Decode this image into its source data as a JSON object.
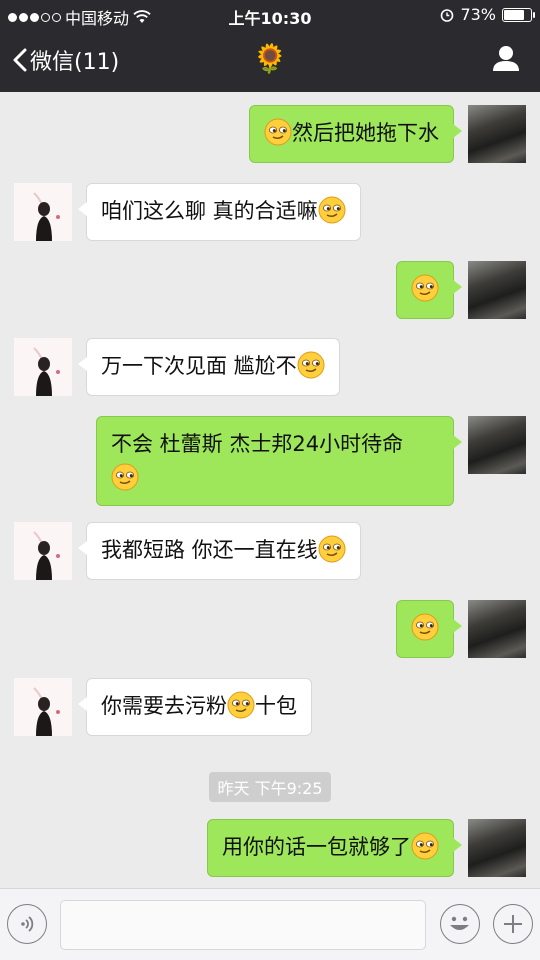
{
  "status_bar": {
    "carrier": "中国移动",
    "time": "上午10:30",
    "battery": "73%",
    "battery_level": 0.73
  },
  "nav": {
    "back_label": "微信(11)",
    "title_emoji": "🌻"
  },
  "messages": [
    {
      "from": "me",
      "text": "然后把她拖下水",
      "emoji_pos": "start"
    },
    {
      "from": "them",
      "text": "咱们这么聊 真的合适嘛",
      "emoji_pos": "end"
    },
    {
      "from": "me",
      "text": "",
      "emoji_pos": "only"
    },
    {
      "from": "them",
      "text": "万一下次见面 尴尬不",
      "emoji_pos": "end"
    },
    {
      "from": "me",
      "text": "不会  杜蕾斯 杰士邦24小时待命",
      "emoji_pos": "newline"
    },
    {
      "from": "them",
      "text": "我都短路 你还一直在线",
      "emoji_pos": "end"
    },
    {
      "from": "me",
      "text": "",
      "emoji_pos": "only"
    },
    {
      "from": "them",
      "text_before": "你需要去污粉",
      "text_after": "十包",
      "emoji_pos": "middle"
    },
    {
      "from": "me",
      "text": "用你的话一包就够了",
      "emoji_pos": "end"
    }
  ],
  "timestamp": "昨天 下午9:25",
  "colors": {
    "my_bubble": "#9ee65a",
    "their_bubble": "#ffffff",
    "chat_background": "#ebebeb",
    "nav_background": "#2b2b2f"
  },
  "icons": {
    "emoji": "smirk-face-icon",
    "voice": "voice-icon",
    "emoji_button": "smile-icon",
    "plus": "plus-icon",
    "profile": "person-icon",
    "back": "chevron-left-icon",
    "wifi": "wifi-icon",
    "alarm": "alarm-icon"
  }
}
